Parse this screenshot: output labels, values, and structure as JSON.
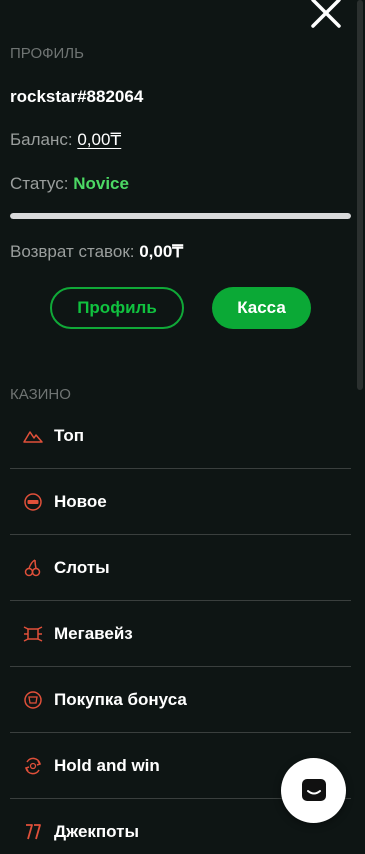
{
  "profile_section": {
    "title": "ПРОФИЛЬ",
    "username": "rockstar#882064",
    "balance_label": "Баланс:",
    "balance_value": "0,00₸",
    "status_label": "Статус:",
    "status_value": "Novice",
    "level_progress": 1.0,
    "bet_return_label": "Возврат ставок:",
    "bet_return_value": "0,00₸",
    "profile_button": "Профиль",
    "cashier_button": "Касса"
  },
  "casino_section": {
    "title": "КАЗИНО",
    "items": [
      {
        "label": "Топ",
        "icon": "top-icon"
      },
      {
        "label": "Новое",
        "icon": "new-icon"
      },
      {
        "label": "Слоты",
        "icon": "slots-icon"
      },
      {
        "label": "Мегавейз",
        "icon": "megaways-icon"
      },
      {
        "label": "Покупка бонуса",
        "icon": "bonus-buy-icon"
      },
      {
        "label": "Hold and win",
        "icon": "hold-and-win-icon"
      },
      {
        "label": "Джекпоты",
        "icon": "jackpots-icon"
      }
    ]
  },
  "colors": {
    "background": "#0e1514",
    "accent_green": "#0ba936",
    "status_green": "#4cd964",
    "icon_red": "#e0503a"
  }
}
